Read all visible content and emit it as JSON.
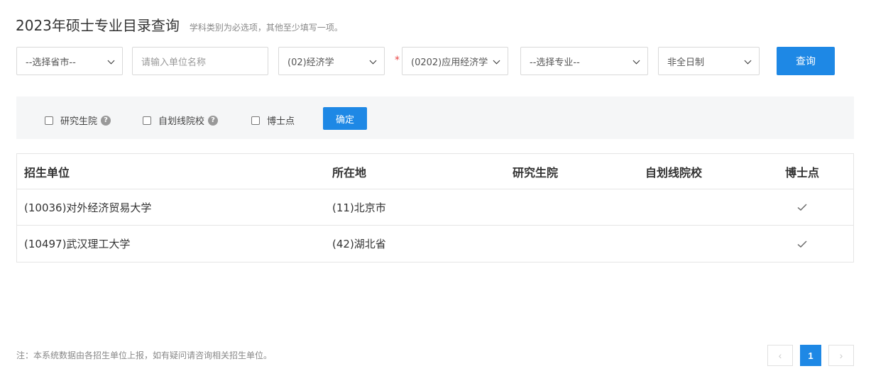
{
  "header": {
    "title": "2023年硕士专业目录查询",
    "subtitle": "学科类别为必选项，其他至少填写一项。"
  },
  "filters": {
    "province": "--选择省市--",
    "unit_placeholder": "请输入单位名称",
    "category": "(02)经济学",
    "required_mark": "*",
    "discipline": "(0202)应用经济学",
    "major": "--选择专业--",
    "study_mode": "非全日制",
    "query_label": "查询"
  },
  "options": {
    "grad_school": "研究生院",
    "self_line": "自划线院校",
    "doctoral": "博士点",
    "help_glyph": "?",
    "confirm_label": "确定"
  },
  "table": {
    "headers": [
      "招生单位",
      "所在地",
      "研究生院",
      "自划线院校",
      "博士点"
    ],
    "rows": [
      {
        "unit": "(10036)对外经济贸易大学",
        "location": "(11)北京市",
        "grad_school": false,
        "self_line": false,
        "doctoral": true
      },
      {
        "unit": "(10497)武汉理工大学",
        "location": "(42)湖北省",
        "grad_school": false,
        "self_line": false,
        "doctoral": true
      }
    ]
  },
  "footer": {
    "note": "注：本系统数据由各招生单位上报，如有疑问请咨询相关招生单位。",
    "prev": "‹",
    "page": "1",
    "next": "›"
  },
  "colors": {
    "primary": "#1e88e5",
    "required": "#e94545"
  }
}
